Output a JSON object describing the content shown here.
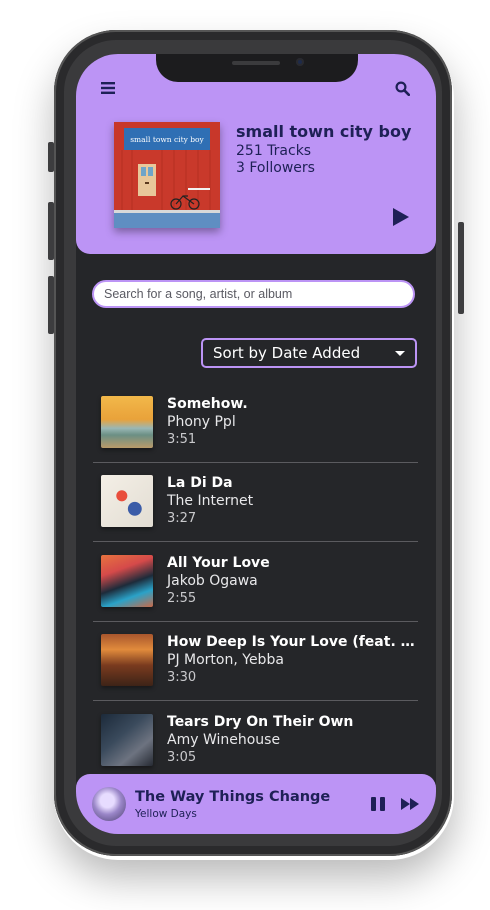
{
  "colors": {
    "accent": "#bc94f5",
    "navy": "#1e2056",
    "background": "#252629"
  },
  "header": {
    "menu_icon": "hamburger-menu-icon",
    "search_icon": "search-icon",
    "playlist": {
      "cover_title": "small town city boy",
      "title": "small town city boy",
      "tracks": "251 Tracks",
      "followers": "3 Followers"
    },
    "play_icon": "play-icon"
  },
  "search": {
    "placeholder": "Search for a song, artist, or album"
  },
  "sort": {
    "label": "Sort by Date Added",
    "icon": "caret-down-icon"
  },
  "tracks": [
    {
      "title": "Somehow.",
      "artist": "Phony Ppl",
      "duration": "3:51"
    },
    {
      "title": "La Di Da",
      "artist": "The Internet",
      "duration": "3:27"
    },
    {
      "title": "All Your Love",
      "artist": "Jakob Ogawa",
      "duration": "2:55"
    },
    {
      "title": "How Deep Is Your Love (feat. Ye...",
      "artist": "PJ Morton, Yebba",
      "duration": "3:30"
    },
    {
      "title": "Tears Dry On Their Own",
      "artist": "Amy Winehouse",
      "duration": "3:05"
    }
  ],
  "now_playing": {
    "title": "The Way Things Change",
    "artist": "Yellow Days",
    "pause_icon": "pause-icon",
    "skip_icon": "skip-forward-icon"
  }
}
